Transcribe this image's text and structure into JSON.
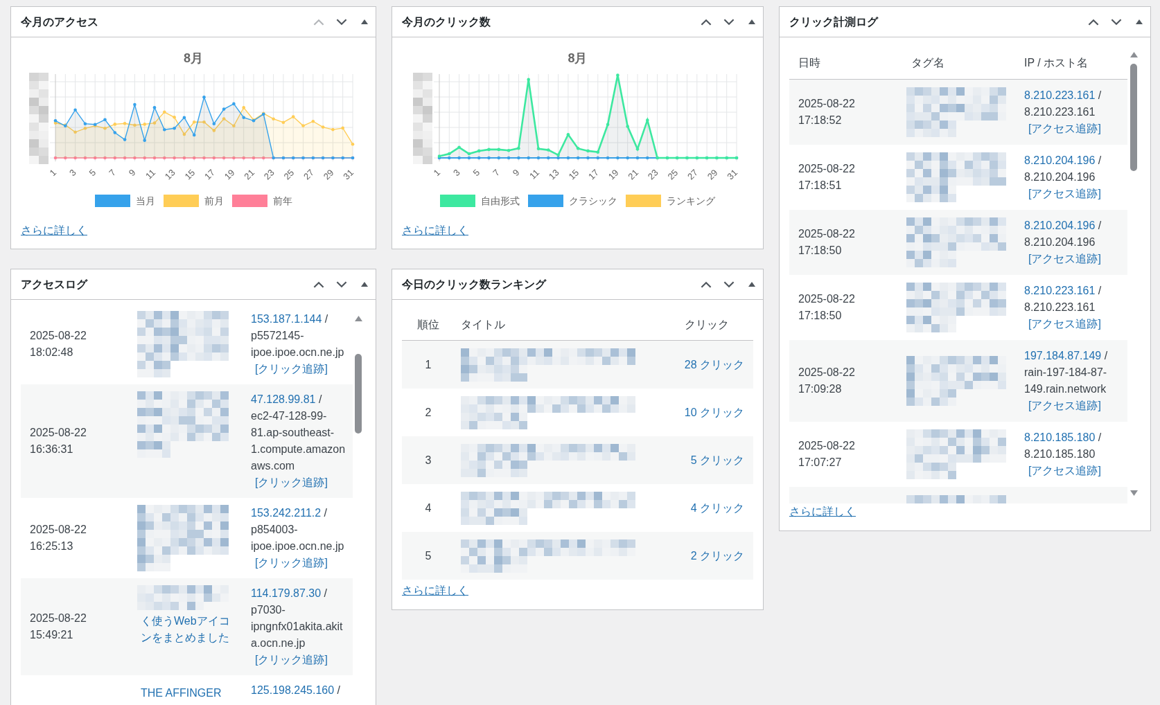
{
  "columns": [
    {
      "panels": [
        {
          "kind": "chart",
          "title": "今月のアクセス",
          "up_disabled": true,
          "chart": {
            "title": "8月",
            "x_labels": [
              "1",
              "3",
              "5",
              "7",
              "9",
              "11",
              "13",
              "15",
              "17",
              "19",
              "21",
              "23",
              "25",
              "27",
              "29",
              "31"
            ],
            "legend": [
              {
                "label": "当月",
                "color": "#36a2eb"
              },
              {
                "label": "前月",
                "color": "#ffcd56"
              },
              {
                "label": "前年",
                "color": "#ff7f98"
              }
            ]
          },
          "more_link": "さらに詳しく"
        },
        {
          "kind": "access_log",
          "title": "アクセスログ",
          "up_disabled": false,
          "rows": [
            {
              "date": "2025-08-22",
              "time": "18:02:48",
              "obscured": true,
              "ip": "153.187.1.144",
              "sep": "/",
              "host": "p5572145-ipoe.ipoe.ocn.ne.jp",
              "track": "[クリック追跡]"
            },
            {
              "date": "2025-08-22",
              "time": "16:36:31",
              "obscured": true,
              "ip": "47.128.99.81",
              "sep": "/",
              "host": "ec2-47-128-99-81.ap-southeast-1.compute.amazonaws.com",
              "track": "[クリック追跡]"
            },
            {
              "date": "2025-08-22",
              "time": "16:25:13",
              "obscured": true,
              "ip": "153.242.211.2",
              "sep": "/",
              "host": "p854003-ipoe.ipoe.ocn.ne.jp",
              "track": "[クリック追跡]"
            },
            {
              "date": "2025-08-22",
              "time": "15:49:21",
              "obscured": true,
              "title": "く使うWebアイコンをまとめました",
              "ip": "114.179.87.30",
              "sep": "/",
              "host": "p7030-ipngnfx01akita.akita.ocn.ne.jp",
              "track": "[クリック追跡]"
            },
            {
              "obscured": false,
              "title": "THE AFFINGER",
              "ip": "125.198.245.160",
              "sep": "/"
            }
          ]
        }
      ]
    },
    {
      "panels": [
        {
          "kind": "chart",
          "title": "今月のクリック数",
          "up_disabled": false,
          "chart": {
            "title": "8月",
            "x_labels": [
              "1",
              "3",
              "5",
              "7",
              "9",
              "11",
              "13",
              "15",
              "17",
              "19",
              "21",
              "23",
              "25",
              "27",
              "29",
              "31"
            ],
            "legend": [
              {
                "label": "自由形式",
                "color": "#3de8a0"
              },
              {
                "label": "クラシック",
                "color": "#36a2eb"
              },
              {
                "label": "ランキング",
                "color": "#ffcd56"
              }
            ]
          },
          "more_link": "さらに詳しく"
        },
        {
          "kind": "ranking",
          "title": "今日のクリック数ランキング",
          "up_disabled": false,
          "columns": [
            "順位",
            "タイトル",
            "クリック"
          ],
          "rows": [
            {
              "rank": "1",
              "obscured": true,
              "clicks": "28 クリック"
            },
            {
              "rank": "2",
              "obscured": true,
              "clicks": "10 クリック"
            },
            {
              "rank": "3",
              "obscured": true,
              "clicks": "5 クリック"
            },
            {
              "rank": "4",
              "obscured": true,
              "clicks": "4 クリック"
            },
            {
              "rank": "5",
              "obscured": true,
              "clicks": "2 クリック"
            }
          ],
          "more_link": "さらに詳しく"
        }
      ]
    },
    {
      "panels": [
        {
          "kind": "click_log",
          "title": "クリック計測ログ",
          "up_disabled": false,
          "columns": [
            "日時",
            "タグ名",
            "IP / ホスト名"
          ],
          "rows": [
            {
              "date": "2025-08-22",
              "time": "17:18:52",
              "obscured": true,
              "ip": "8.210.223.161",
              "sep": "/",
              "host": "8.210.223.161",
              "track": "[アクセス追跡]"
            },
            {
              "date": "2025-08-22",
              "time": "17:18:51",
              "obscured": true,
              "ip": "8.210.204.196",
              "sep": "/",
              "host": "8.210.204.196",
              "track": "[アクセス追跡]"
            },
            {
              "date": "2025-08-22",
              "time": "17:18:50",
              "obscured": true,
              "ip": "8.210.204.196",
              "sep": "/",
              "host": "8.210.204.196",
              "track": "[アクセス追跡]"
            },
            {
              "date": "2025-08-22",
              "time": "17:18:50",
              "obscured": true,
              "ip": "8.210.223.161",
              "sep": "/",
              "host": "8.210.223.161",
              "track": "[アクセス追跡]"
            },
            {
              "date": "2025-08-22",
              "time": "17:09:28",
              "obscured": true,
              "ip": "197.184.87.149",
              "sep": "/",
              "host": "rain-197-184-87-149.rain.network",
              "track": "[アクセス追跡]"
            },
            {
              "date": "2025-08-22",
              "time": "17:07:27",
              "obscured": true,
              "ip": "8.210.185.180",
              "sep": "/",
              "host": "8.210.185.180",
              "track": "[アクセス追跡]"
            },
            {
              "obscured": true
            }
          ],
          "more_link": "さらに詳しく"
        }
      ]
    }
  ]
}
